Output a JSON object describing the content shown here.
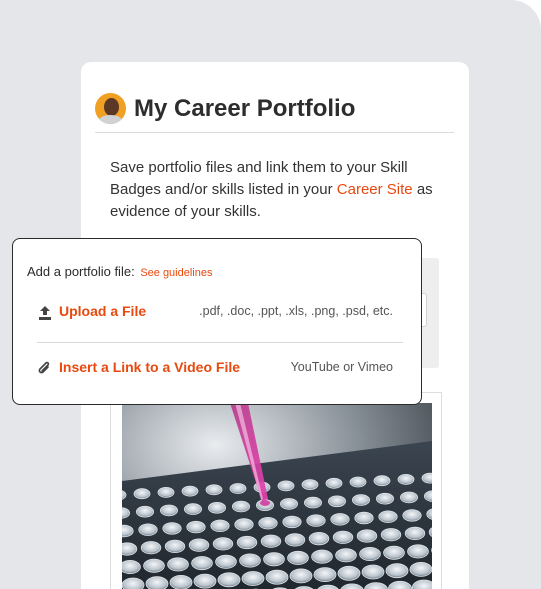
{
  "portfolio": {
    "title": "My Career Portfolio",
    "description_before": "Save portfolio files and link them to your Skill Badges and/or skills listed in your ",
    "career_site_link": "Career Site",
    "description_after": " as evidence of your skills."
  },
  "add_file_popup": {
    "heading": "Add a portfolio file:",
    "guidelines_link": "See guidelines",
    "options": [
      {
        "label": "Upload a File",
        "hint": ".pdf, .doc, .ppt, .xls, .png, .psd, etc.",
        "icon": "upload-icon"
      },
      {
        "label": "Insert a Link to a Video File",
        "hint": "YouTube or Vimeo",
        "icon": "paperclip-icon"
      }
    ]
  },
  "colors": {
    "accent": "#e8490f",
    "background": "#e5e6e9"
  }
}
